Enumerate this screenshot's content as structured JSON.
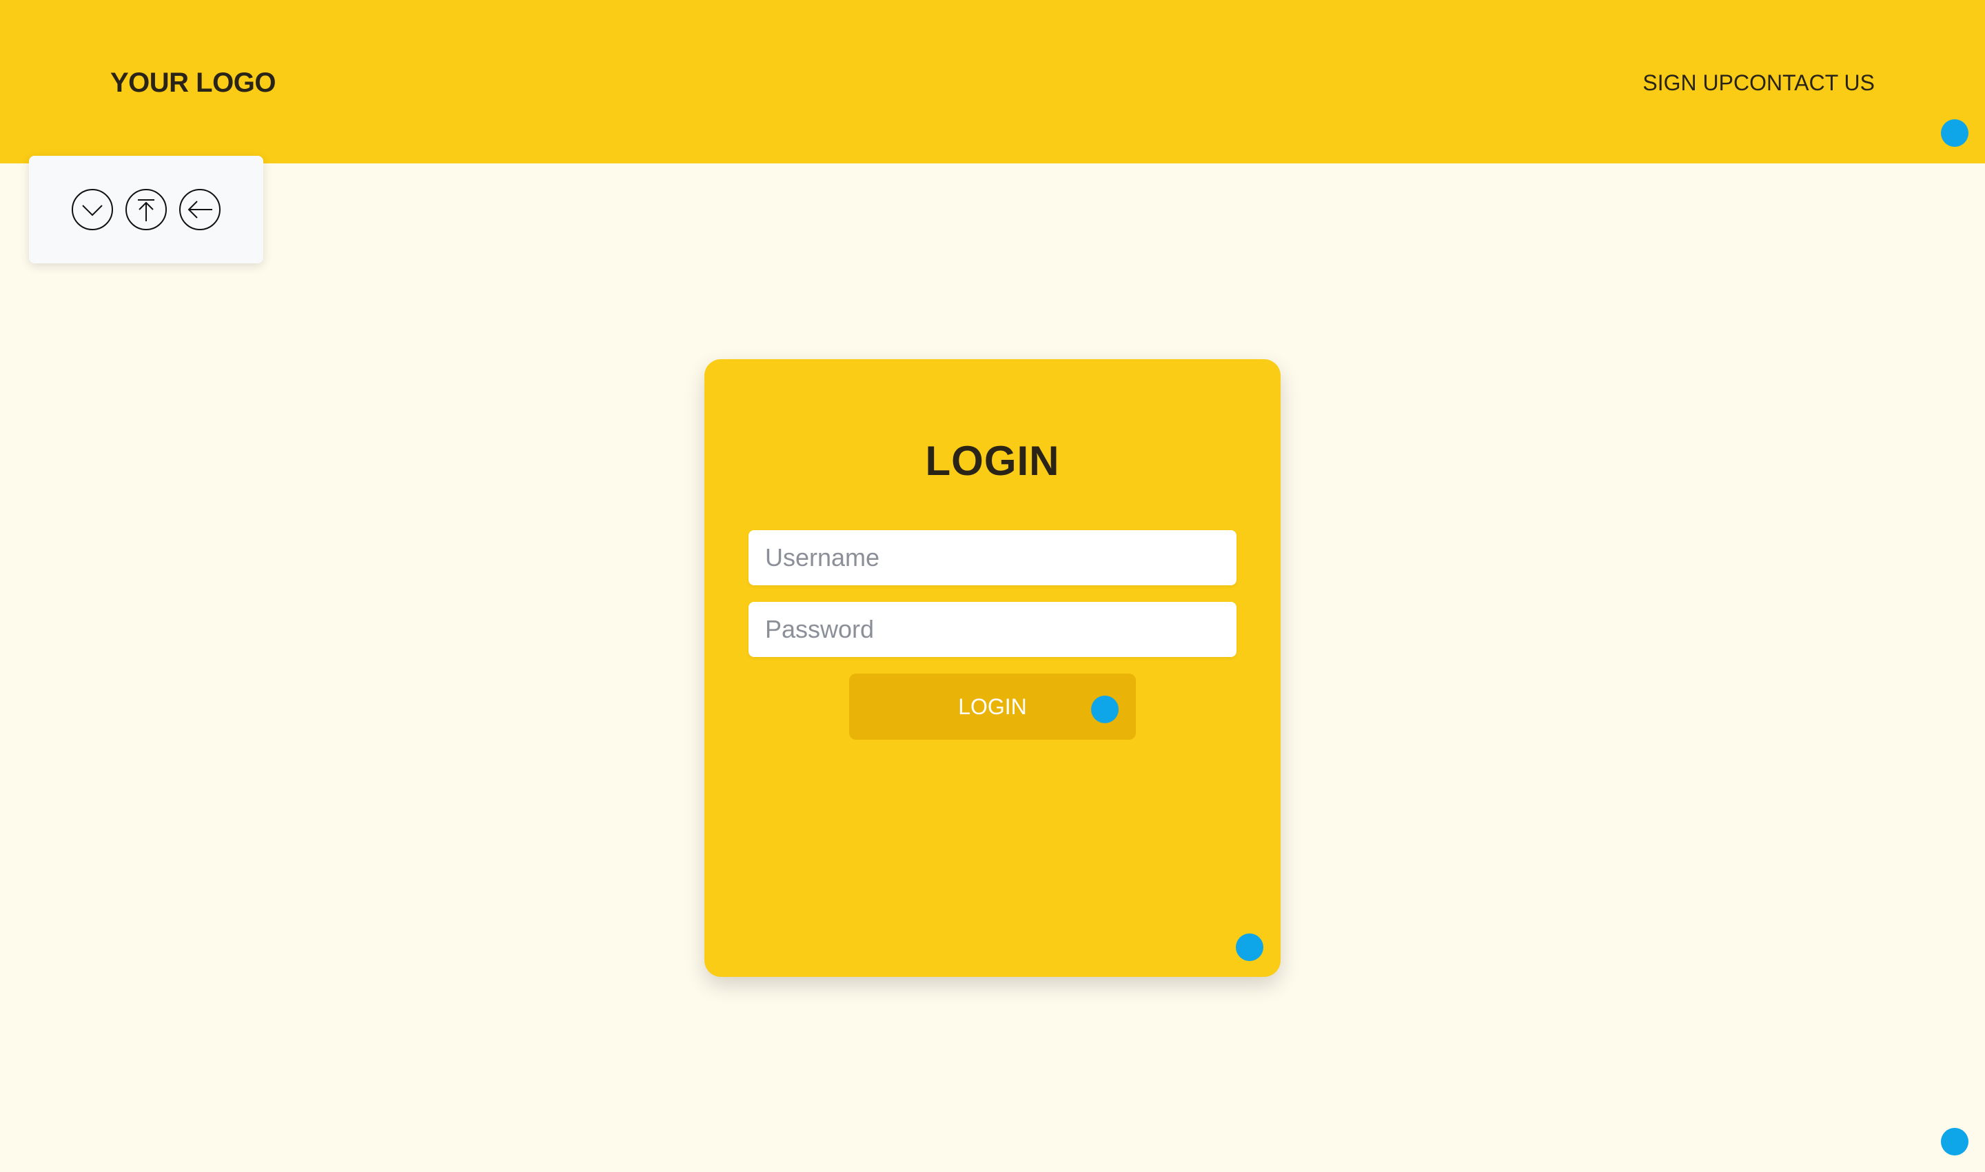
{
  "header": {
    "logo": "YOUR LOGO",
    "nav": {
      "signup": "SIGN UP",
      "contact": "CONTACT US"
    }
  },
  "toolbar": {
    "icons": [
      "chevron-down-circle-icon",
      "arrow-up-to-top-circle-icon",
      "arrow-left-circle-icon"
    ]
  },
  "login_card": {
    "title": "LOGIN",
    "username_placeholder": "Username",
    "username_value": "",
    "password_placeholder": "Password",
    "password_value": "",
    "button_label": "LOGIN"
  },
  "colors": {
    "accent": "#facc15",
    "button": "#eab308",
    "background": "#fefaec",
    "text": "#2a2418",
    "marker": "#0ea5e9"
  }
}
